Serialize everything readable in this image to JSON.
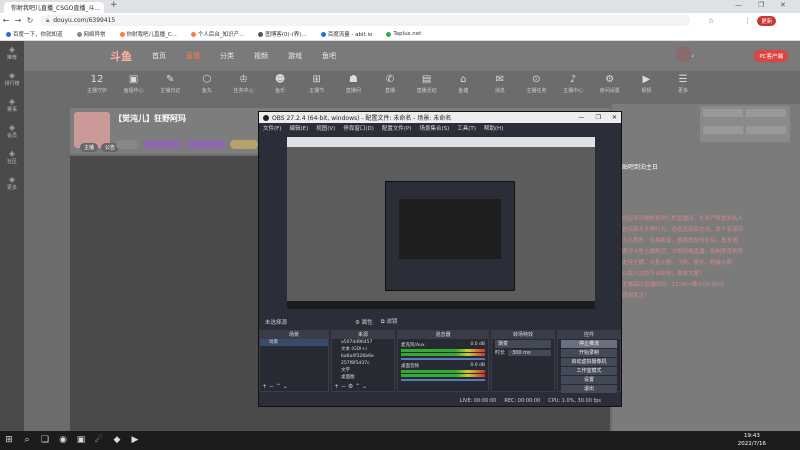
{
  "browser": {
    "tab_title": "你射我吧儿直播_CSGO直播_斗...",
    "url": "douyu.com/6399415",
    "bookmarks": [
      "百度一下，你就知道",
      "网络异常",
      "你射我吧儿直播_C...",
      "个人后台_知识产...",
      "图博客(0)-(界)...",
      "百度流量 - ablt.io",
      "Taplus.net"
    ],
    "update_label": "更新"
  },
  "site": {
    "logo": "斗鱼",
    "nav": [
      "首页",
      "直播",
      "分类",
      "视频",
      "游戏",
      "鱼吧"
    ],
    "active_nav": "直播",
    "pc_client": "PC客户端",
    "left_nav": [
      "推荐",
      "排行榜",
      "赛事",
      "会员",
      "社区",
      "更多"
    ],
    "icon_row": [
      {
        "icon": "12",
        "label": "主播守护"
      },
      {
        "icon": "▣",
        "label": "鱼翅中心"
      },
      {
        "icon": "✎",
        "label": "主播日记"
      },
      {
        "icon": "⬡",
        "label": "鱼丸"
      },
      {
        "icon": "♔",
        "label": "任务中心"
      },
      {
        "icon": "☻",
        "label": "鱼乐"
      },
      {
        "icon": "⊞",
        "label": "主播节"
      },
      {
        "icon": "☗",
        "label": "直播间"
      },
      {
        "icon": "✆",
        "label": "直播"
      },
      {
        "icon": "▤",
        "label": "直播活动"
      },
      {
        "icon": "⌂",
        "label": "鱼塘"
      },
      {
        "icon": "✉",
        "label": "消息"
      },
      {
        "icon": "⊙",
        "label": "主播任务"
      },
      {
        "icon": "♪",
        "label": "主播中心"
      },
      {
        "icon": "⚙",
        "label": "房间设置"
      },
      {
        "icon": "▶",
        "label": "视频"
      },
      {
        "icon": "☰",
        "label": "更多"
      }
    ],
    "room_title": "【觉沌儿】狂野阿玛",
    "room_tags": [
      "主播",
      "公告"
    ],
    "right_title": "贴吧到泊主日",
    "right_lines": [
      "欢迎来到你射我吧儿的直播间，头条严禁鱼友私人",
      "言论和不文明行为，违者直接禁言到，发个有保持",
      "为人质朴，风格和谐，感谢鱼友的支持，鱼友请",
      "遵守斗鱼主播规范，文明观看直播，抵制恶意刷屏",
      "支持主播，斗鱼火箭、飞机、鱼丸、超级火箭",
      "以及入驻的平台粉丝，谢谢大家！",
      "主播每日直播时间：11:00~晚上00:00点",
      "感谢关注！"
    ]
  },
  "obs": {
    "title": "OBS 27.2.4 (64-bit, windows) - 配置文件: 未命名 - 场景: 未命名",
    "menu": [
      "文件(F)",
      "编辑(E)",
      "视图(V)",
      "停靠窗口(D)",
      "配置文件(P)",
      "场景集合(S)",
      "工具(T)",
      "帮助(H)"
    ],
    "source_label": "未选择源",
    "prop_tabs": [
      "属性",
      "滤镜"
    ],
    "scenes_header": "场景",
    "scenes": [
      "场景"
    ],
    "sources_header": "来源",
    "sources": [
      "a5074d96457",
      "文本 (GDI+)",
      "ba6a4f326b6e",
      "257f8f5d37c",
      "文字",
      "桌面图"
    ],
    "mixer_header": "混音器",
    "mixer": [
      {
        "name": "麦克风/Aux",
        "db": "0.0 dB"
      },
      {
        "name": "桌面音频",
        "db": "0.0 dB"
      }
    ],
    "transitions_header": "转场特效",
    "transition_type": "渐变",
    "duration_label": "时长",
    "duration_value": "300 ms",
    "controls_header": "控件",
    "controls": [
      "停止推流",
      "开始录制",
      "启动虚拟摄像机",
      "工作室模式",
      "设置",
      "退出"
    ],
    "status": {
      "live": "LIVE: 00:00:00",
      "rec": "REC: 00:00:00",
      "cpu": "CPU: 1.0%, 30.00 fps"
    }
  },
  "taskbar": {
    "apps": [
      "⊞",
      "⌕",
      "❑",
      "◉",
      "▣",
      "☄",
      "◆",
      "▶"
    ],
    "time": "19:43",
    "date": "2022/7/16"
  },
  "colors": {
    "accent": "#ff7a45",
    "obs_bg": "#2b2e38"
  }
}
